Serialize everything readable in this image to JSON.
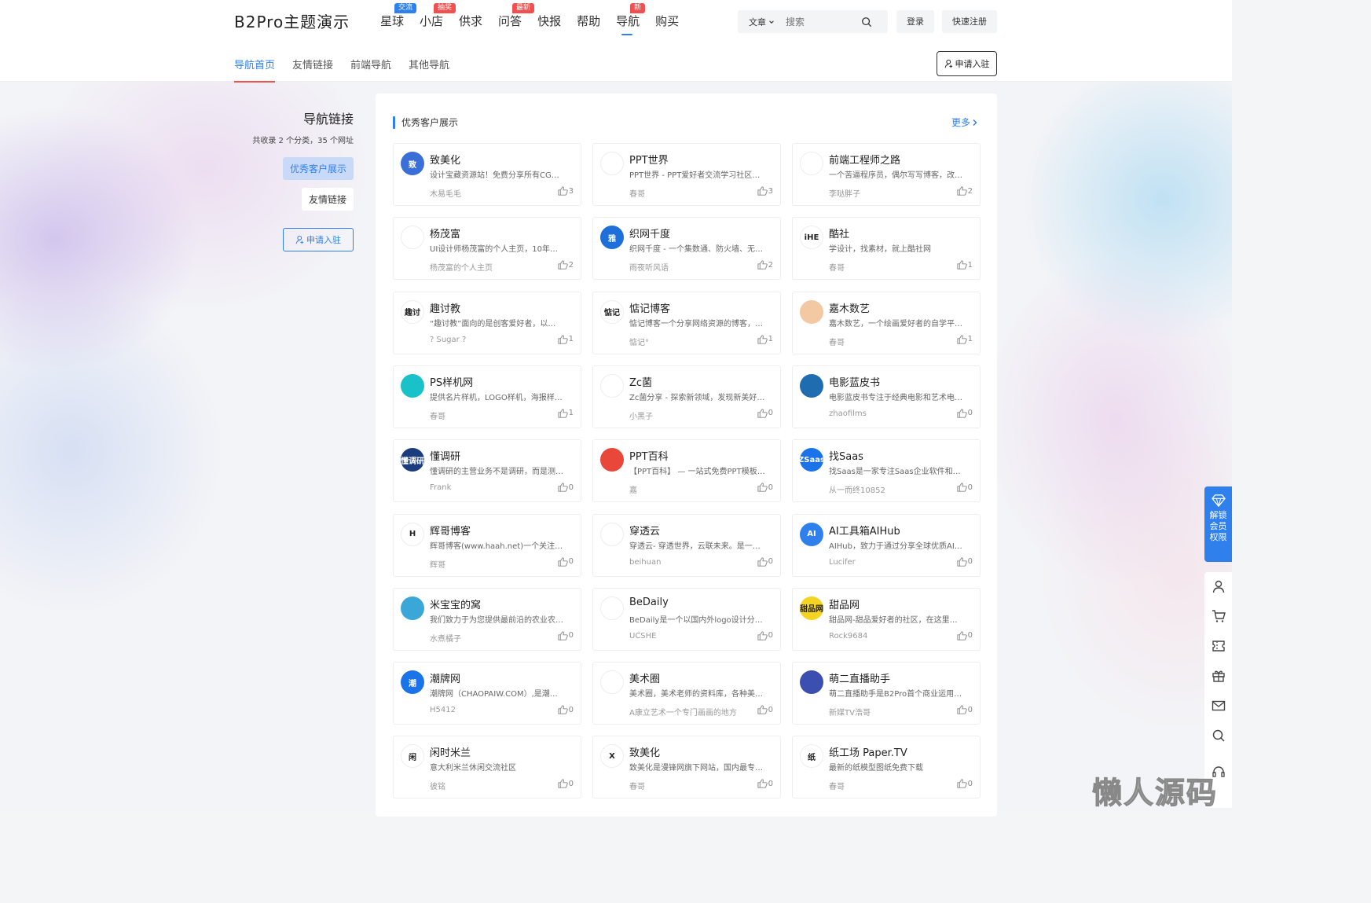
{
  "header": {
    "logo": "B2Pro主题演示",
    "nav": [
      {
        "label": "星球",
        "badge": "交流",
        "badge_color": "#2f80ed"
      },
      {
        "label": "小店",
        "badge": "抽奖",
        "badge_color": "#f0504f"
      },
      {
        "label": "供求",
        "badge": "",
        "badge_color": ""
      },
      {
        "label": "问答",
        "badge": "最新",
        "badge_color": "#f0504f"
      },
      {
        "label": "快报",
        "badge": "",
        "badge_color": ""
      },
      {
        "label": "帮助",
        "badge": "",
        "badge_color": ""
      },
      {
        "label": "导航",
        "badge": "新",
        "badge_color": "#f0504f",
        "active": true
      },
      {
        "label": "购买",
        "badge": "",
        "badge_color": ""
      }
    ],
    "search": {
      "type": "文章",
      "placeholder": "搜索"
    },
    "login": "登录",
    "register": "快速注册"
  },
  "subnav": {
    "items": [
      "导航首页",
      "友情链接",
      "前端导航",
      "其他导航"
    ],
    "active_index": 0,
    "apply": "申请入驻"
  },
  "sidebar": {
    "title": "导航链接",
    "summary": "共收录 2 个分类，35 个网址",
    "categories": [
      "优秀客户展示",
      "友情链接"
    ],
    "apply": "申请入驻"
  },
  "panel": {
    "title": "优秀客户展示",
    "more": "更多",
    "cards": [
      {
        "name": "致美化",
        "desc": "设计宝藏资源站！免费分享所有CG…",
        "author": "木易毛毛",
        "likes": "3",
        "logo_color": "#3b6fd8",
        "logo_text": "致"
      },
      {
        "name": "PPT世界",
        "desc": "PPT世界 - PPT爱好者交流学习社区…",
        "author": "春哥",
        "likes": "3",
        "logo_color": "#ffffff",
        "logo_text": ""
      },
      {
        "name": "前端工程师之路",
        "desc": "一个苦逼程序员，偶尔写写博客，改…",
        "author": "李哒胖子",
        "likes": "2",
        "logo_color": "#ffffff",
        "logo_text": ""
      },
      {
        "name": "杨茂富",
        "desc": "UI设计师杨茂富的个人主页，10年…",
        "author": "杨茂富的个人主页",
        "likes": "2",
        "logo_color": "#ffffff",
        "logo_text": ""
      },
      {
        "name": "织网千度",
        "desc": "织网千度 - 一个集数通、防火墙、无…",
        "author": "雨夜听风语",
        "likes": "2",
        "logo_color": "#1e6fd9",
        "logo_text": "雅"
      },
      {
        "name": "酷社",
        "desc": "学设计，找素材，就上酷社网",
        "author": "春哥",
        "likes": "1",
        "logo_color": "#ffffff",
        "logo_text": "iHE"
      },
      {
        "name": "趣讨教",
        "desc": "“趣讨教”面向的是创客爱好者，以…",
        "author": "? Sugar ?",
        "likes": "1",
        "logo_color": "#ffffff",
        "logo_text": "趣讨"
      },
      {
        "name": "惦记博客",
        "desc": "惦记博客一个分享网络资源的博客，…",
        "author": "惦记°",
        "likes": "1",
        "logo_color": "#ffffff",
        "logo_text": "惦记"
      },
      {
        "name": "嘉木数艺",
        "desc": "嘉木数艺，一个绘画爱好者的自学平…",
        "author": "春哥",
        "likes": "1",
        "logo_color": "#f3c9a4",
        "logo_text": ""
      },
      {
        "name": "PS样机网",
        "desc": "提供名片样机，LOGO样机，海报样…",
        "author": "春哥",
        "likes": "1",
        "logo_color": "#19c2c9",
        "logo_text": ""
      },
      {
        "name": "Zc菌",
        "desc": "Zc菌分享 - 探索新领域，发现新美好…",
        "author": "小黑子",
        "likes": "0",
        "logo_color": "#ffffff",
        "logo_text": ""
      },
      {
        "name": "电影蓝皮书",
        "desc": "电影蓝皮书专注于经典电影和艺术电…",
        "author": "zhaofilms",
        "likes": "0",
        "logo_color": "#1f6db0",
        "logo_text": ""
      },
      {
        "name": "懂调研",
        "desc": "懂调研的主营业务不是调研，而是测…",
        "author": "Frank",
        "likes": "0",
        "logo_color": "#1b3d7d",
        "logo_text": "懂调研"
      },
      {
        "name": "PPT百科",
        "desc": "【PPT百科】 — 一站式免费PPT模板…",
        "author": "嘉",
        "likes": "0",
        "logo_color": "#e8473a",
        "logo_text": ""
      },
      {
        "name": "找Saas",
        "desc": "找Saas是一家专注Saas企业软件和…",
        "author": "从一而终10852",
        "likes": "0",
        "logo_color": "#1a73e8",
        "logo_text": "ZSaas"
      },
      {
        "name": "辉哥博客",
        "desc": "辉哥博客(www.haah.net)一个关注…",
        "author": "辉哥",
        "likes": "0",
        "logo_color": "#ffffff",
        "logo_text": "H"
      },
      {
        "name": "穿透云",
        "desc": "穿透云- 穿透世界，云联未来。是一…",
        "author": "beihuan",
        "likes": "0",
        "logo_color": "#ffffff",
        "logo_text": ""
      },
      {
        "name": "AI工具箱AIHub",
        "desc": "AIHub，致力于通过分享全球优质AI…",
        "author": "Lucifer",
        "likes": "0",
        "logo_color": "#2f80ed",
        "logo_text": "AI"
      },
      {
        "name": "米宝宝的窝",
        "desc": "我们致力于为您提供最前沿的农业农…",
        "author": "水煮橘子",
        "likes": "0",
        "logo_color": "#3aa7d8",
        "logo_text": ""
      },
      {
        "name": "BeDaily",
        "desc": "BeDaily是一个以国内外logo设计分…",
        "author": "UCSHE",
        "likes": "0",
        "logo_color": "#ffffff",
        "logo_text": ""
      },
      {
        "name": "甜品网",
        "desc": "甜品网-甜品爱好者的社区，在这里…",
        "author": "Rock9684",
        "likes": "0",
        "logo_color": "#f5d321",
        "logo_text": "甜品网"
      },
      {
        "name": "潮牌网",
        "desc": "潮牌网（CHAOPAIW.COM）,是潮…",
        "author": "H5412",
        "likes": "0",
        "logo_color": "#1a73e8",
        "logo_text": "潮"
      },
      {
        "name": "美术圈",
        "desc": "美术圈，美术老师的资料库，各种美…",
        "author": "A康立艺术一个专门画画的地方",
        "likes": "0",
        "logo_color": "#ffffff",
        "logo_text": ""
      },
      {
        "name": "萌二直播助手",
        "desc": "萌二直播助手是B2Pro首个商业运用…",
        "author": "新媒TV浩哥",
        "likes": "0",
        "logo_color": "#3b4fb0",
        "logo_text": ""
      },
      {
        "name": "闲时米兰",
        "desc": "意大利米兰休闲交流社区",
        "author": "彼铭",
        "likes": "0",
        "logo_color": "#ffffff",
        "logo_text": "闲"
      },
      {
        "name": "致美化",
        "desc": "致美化是漫锋网旗下网站，国内最专…",
        "author": "春哥",
        "likes": "0",
        "logo_color": "#ffffff",
        "logo_text": "X"
      },
      {
        "name": "纸工场 Paper.TV",
        "desc": "最新的纸模型图纸免费下载",
        "author": "春哥",
        "likes": "0",
        "logo_color": "#ffffff",
        "logo_text": "纸"
      }
    ]
  },
  "floating": {
    "vip_label": [
      "解锁",
      "会员",
      "权限"
    ],
    "tools": [
      "user-icon",
      "cart-icon",
      "ticket-icon",
      "gift-icon",
      "message-icon",
      "search-icon",
      "headset-icon"
    ]
  },
  "watermark": "懒人源码"
}
